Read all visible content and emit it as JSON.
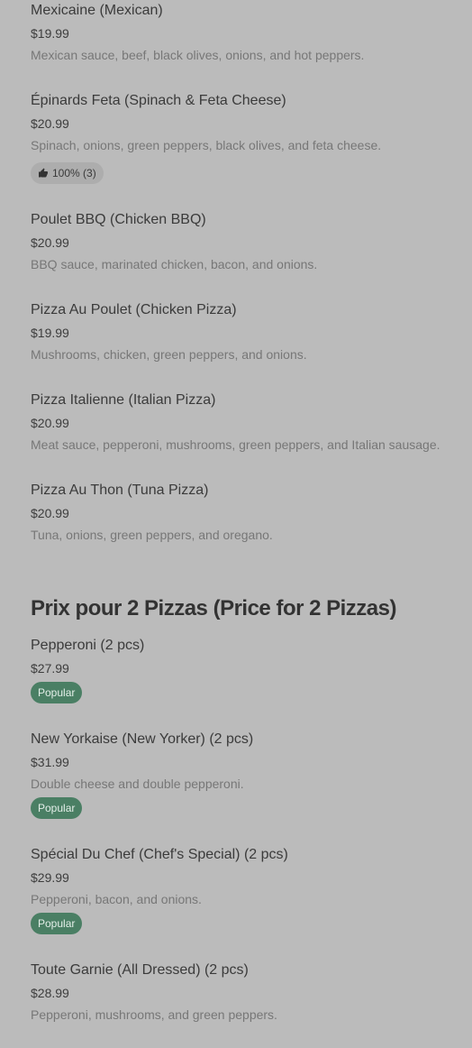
{
  "items": [
    {
      "name": "Mexicaine (Mexican)",
      "price": "$19.99",
      "description": "Mexican sauce, beef, black olives, onions, and hot peppers."
    },
    {
      "name": "Épinards Feta (Spinach & Feta Cheese)",
      "price": "$20.99",
      "description": "Spinach, onions, green peppers, black olives, and feta cheese.",
      "rating": "100% (3)"
    },
    {
      "name": "Poulet BBQ (Chicken BBQ)",
      "price": "$20.99",
      "description": "BBQ sauce, marinated chicken, bacon, and onions."
    },
    {
      "name": "Pizza Au Poulet (Chicken Pizza)",
      "price": "$19.99",
      "description": "Mushrooms, chicken, green peppers, and onions."
    },
    {
      "name": "Pizza Italienne (Italian Pizza)",
      "price": "$20.99",
      "description": "Meat sauce, pepperoni, mushrooms, green peppers, and Italian sausage."
    },
    {
      "name": "Pizza Au Thon (Tuna Pizza)",
      "price": "$20.99",
      "description": "Tuna, onions, green peppers, and oregano."
    }
  ],
  "section2": {
    "title": "Prix pour 2 Pizzas (Price for 2 Pizzas)",
    "items": [
      {
        "name": "Pepperoni (2 pcs)",
        "price": "$27.99",
        "badge": "Popular"
      },
      {
        "name": "New Yorkaise (New Yorker) (2 pcs)",
        "price": "$31.99",
        "description": "Double cheese and double pepperoni.",
        "badge": "Popular"
      },
      {
        "name": "Spécial Du Chef (Chef's Special) (2 pcs)",
        "price": "$29.99",
        "description": "Pepperoni, bacon, and onions.",
        "badge": "Popular"
      },
      {
        "name": "Toute Garnie (All Dressed) (2 pcs)",
        "price": "$28.99",
        "description": "Pepperoni, mushrooms, and green peppers."
      }
    ]
  },
  "colors": {
    "background": "#bbbbbb",
    "popular_badge": "#4a7f64",
    "rating_badge": "#adadad"
  },
  "icons": {
    "rating": "thumbs-up-icon"
  }
}
